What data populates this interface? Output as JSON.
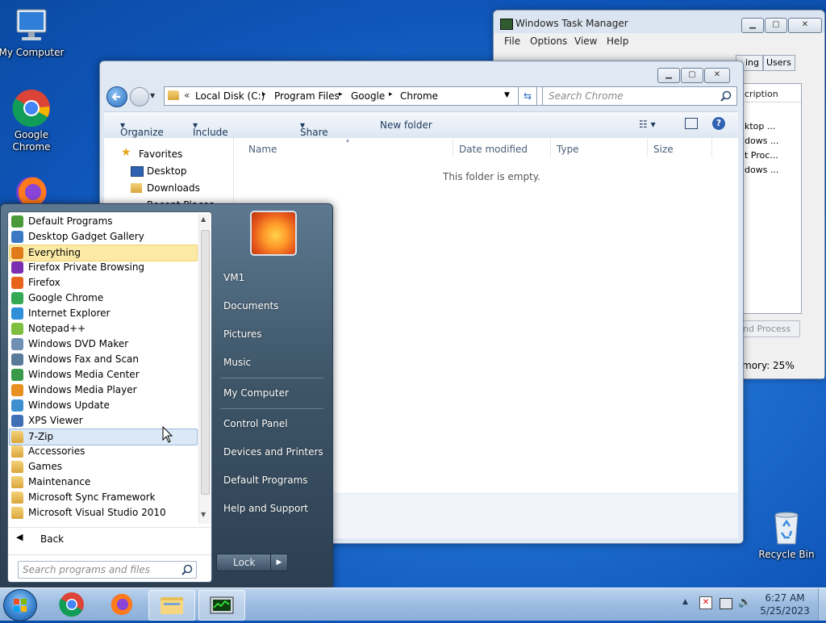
{
  "desktop": {
    "icons": [
      {
        "label": "My Computer",
        "icon": "computer-icon"
      },
      {
        "label": "Google\nChrome",
        "icon": "chrome-icon"
      },
      {
        "label": "Recycle Bin",
        "icon": "recycle-bin-icon"
      }
    ]
  },
  "task_manager": {
    "title": "Windows Task Manager",
    "menu": [
      "File",
      "Options",
      "View",
      "Help"
    ],
    "tab_users": "Users",
    "tab_partial": "ing",
    "col_description": "cription",
    "rows": [
      "ktop ...",
      "dows ...",
      "t Proc...",
      "dows ..."
    ],
    "end_process_button": "nd Process",
    "status_memory": "mory: 25%"
  },
  "explorer": {
    "breadcrumb": [
      "Local Disk (C:)",
      "Program Files",
      "Google",
      "Chrome"
    ],
    "search_placeholder": "Search Chrome",
    "toolbar": {
      "organize": "Organize",
      "include": "Include in library",
      "share": "Share with",
      "new_folder": "New folder"
    },
    "nav": {
      "favorites": "Favorites",
      "desktop": "Desktop",
      "downloads": "Downloads",
      "recent": "Recent Places"
    },
    "columns": {
      "name": "Name",
      "date": "Date modified",
      "type": "Type",
      "size": "Size"
    },
    "empty_text": "This folder is empty."
  },
  "start_menu": {
    "programs": [
      {
        "label": "Default Programs",
        "color": "#4a9a3a"
      },
      {
        "label": "Desktop Gadget Gallery",
        "color": "#3b78c4"
      },
      {
        "label": "Everything",
        "color": "#e07a1a",
        "state": "highlight"
      },
      {
        "label": "Firefox Private Browsing",
        "color": "#7a2fb0"
      },
      {
        "label": "Firefox",
        "color": "#e8641a"
      },
      {
        "label": "Google Chrome",
        "color": "#34a853"
      },
      {
        "label": "Internet Explorer",
        "color": "#2f8fd8"
      },
      {
        "label": "Notepad++",
        "color": "#7fbf3f"
      },
      {
        "label": "Windows DVD Maker",
        "color": "#6f8fb5"
      },
      {
        "label": "Windows Fax and Scan",
        "color": "#5a7a9a"
      },
      {
        "label": "Windows Media Center",
        "color": "#3a9a4a"
      },
      {
        "label": "Windows Media Player",
        "color": "#e89020"
      },
      {
        "label": "Windows Update",
        "color": "#3d8fd0"
      },
      {
        "label": "XPS Viewer",
        "color": "#3f6fb5"
      },
      {
        "label": "7-Zip",
        "folder": true,
        "state": "selected"
      },
      {
        "label": "Accessories",
        "folder": true
      },
      {
        "label": "Games",
        "folder": true
      },
      {
        "label": "Maintenance",
        "folder": true
      },
      {
        "label": "Microsoft Sync Framework",
        "folder": true
      },
      {
        "label": "Microsoft Visual Studio 2010",
        "folder": true
      }
    ],
    "back": "Back",
    "search_placeholder": "Search programs and files",
    "right": [
      "VM1",
      "Documents",
      "Pictures",
      "Music",
      "My Computer",
      "Control Panel",
      "Devices and Printers",
      "Default Programs",
      "Help and Support"
    ],
    "lock": "Lock"
  },
  "tray": {
    "time": "6:27 AM",
    "date": "5/25/2023"
  }
}
